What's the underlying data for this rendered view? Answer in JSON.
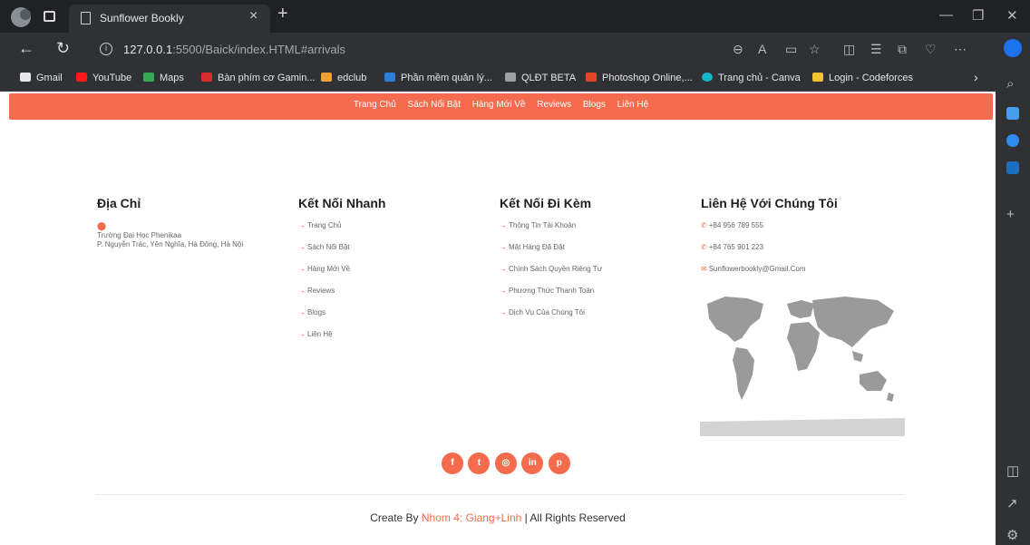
{
  "browser": {
    "tab_title": "Sunflower Bookly",
    "url_host": "127.0.0.1",
    "url_rest": ":5500/Baick/index.HTML#arrivals",
    "bookmarks": [
      "Gmail",
      "YouTube",
      "Maps",
      "Bàn phím cơ Gamin...",
      "edclub",
      "Phần mềm quản lý...",
      "QLĐT BETA",
      "Photoshop Online,...",
      "Trang chủ - Canva",
      "Login - Codeforces"
    ]
  },
  "nav": {
    "items": [
      "Trang Chủ",
      "Sách Nổi Bật",
      "Hàng Mới Về",
      "Reviews",
      "Blogs",
      "Liên Hệ"
    ]
  },
  "footer": {
    "address": {
      "title": "Địa Chỉ",
      "line1": "Trường Đại Học Phenikaa",
      "line2": "P. Nguyễn Trác, Yên Nghĩa, Hà Đông, Hà Nội"
    },
    "quick_links": {
      "title": "Kết Nối Nhanh",
      "items": [
        "Trang Chủ",
        "Sách Nổi Bật",
        "Hàng Mới Về",
        "Reviews",
        "Blogs",
        "Liên Hệ"
      ]
    },
    "extra_links": {
      "title": "Kết Nối Đi Kèm",
      "items": [
        "Thông Tin Tài Khoản",
        "Mặt Hàng Đã Đặt",
        "Chính Sách Quyền Riêng Tư",
        "Phương Thức Thanh Toán",
        "Dịch Vụ Của Chúng Tôi"
      ]
    },
    "contact": {
      "title": "Liên Hệ Với Chúng Tôi",
      "phone1": "+84 956 789 555",
      "phone2": "+84 765 901 223",
      "email": "Sunflowerbookly@Gmail.Com"
    },
    "socials": [
      "facebook-icon",
      "twitter-icon",
      "instagram-icon",
      "linkedin-icon",
      "pinterest-icon"
    ],
    "credit_prefix": "Create By ",
    "credit_name": "Nhom 4: Giang+Linh",
    "credit_suffix": " | All Rights Reserved"
  },
  "colors": {
    "accent": "#f46b4e"
  }
}
